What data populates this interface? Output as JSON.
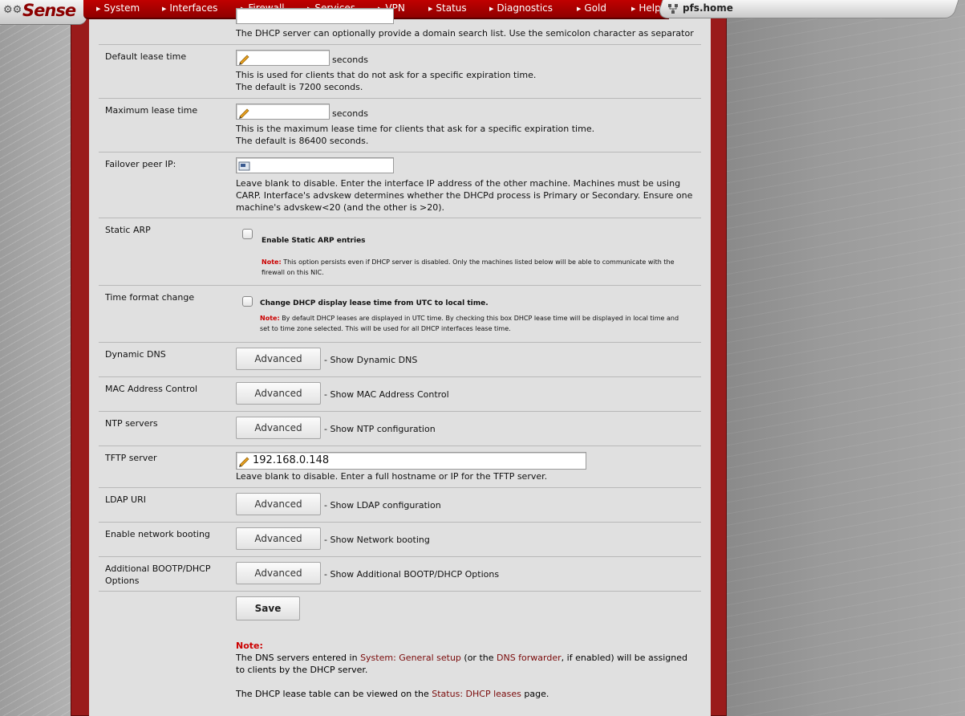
{
  "nav": {
    "logo": "Sense",
    "menu": [
      "System",
      "Interfaces",
      "Firewall",
      "Services",
      "VPN",
      "Status",
      "Diagnostics",
      "Gold",
      "Help"
    ],
    "hostname": "pfs.home"
  },
  "domain_search": {
    "help": "The DHCP server can optionally provide a domain search list. Use the semicolon character as separator"
  },
  "default_lease": {
    "label": "Default lease time",
    "value": "",
    "unit": "seconds",
    "help1": "This is used for clients that do not ask for a specific expiration time.",
    "help2": "The default is 7200 seconds."
  },
  "max_lease": {
    "label": "Maximum lease time",
    "value": "",
    "unit": "seconds",
    "help1": "This is the maximum lease time for clients that ask for a specific expiration time.",
    "help2": "The default is 86400 seconds."
  },
  "failover": {
    "label": "Failover peer IP:",
    "value": "",
    "help1": "Leave blank to disable. Enter the interface IP address of the other machine. Machines must be using",
    "help2": "CARP. Interface's advskew determines whether the DHCPd process is Primary or Secondary. Ensure one",
    "help3": "machine's advskew<20 (and the other is >20)."
  },
  "static_arp": {
    "label": "Static ARP",
    "checkbox_label": "Enable Static ARP entries",
    "checked": false,
    "note_prefix": "Note:",
    "note1": "This option persists even if DHCP server is disabled. Only the machines listed below will be able to communicate with the",
    "note2": "firewall on this NIC."
  },
  "time_format": {
    "label": "Time format change",
    "checkbox_label": "Change DHCP display lease time from UTC to local time.",
    "checked": false,
    "note_prefix": "Note:",
    "note1": "By default DHCP leases are displayed in UTC time. By checking this box DHCP lease time will be displayed in local time and",
    "note2": "set to time zone selected. This will be used for all DHCP interfaces lease time."
  },
  "dynamic_dns": {
    "label": "Dynamic DNS",
    "button": "Advanced",
    "desc": "- Show Dynamic DNS"
  },
  "mac_control": {
    "label": "MAC Address Control",
    "button": "Advanced",
    "desc": "- Show MAC Address Control"
  },
  "ntp": {
    "label": "NTP servers",
    "button": "Advanced",
    "desc": "- Show NTP configuration"
  },
  "tftp": {
    "label": "TFTP server",
    "value": "192.168.0.148",
    "help": "Leave blank to disable. Enter a full hostname or IP for the TFTP server."
  },
  "ldap": {
    "label": "LDAP URI",
    "button": "Advanced",
    "desc": "- Show LDAP configuration"
  },
  "netboot": {
    "label": "Enable network booting",
    "button": "Advanced",
    "desc": "- Show Network booting"
  },
  "bootp": {
    "label": "Additional BOOTP/DHCP Options",
    "button": "Advanced",
    "desc": "- Show Additional BOOTP/DHCP Options"
  },
  "save": "Save",
  "footer": {
    "note_label": "Note:",
    "line1_a": "The DNS servers entered in ",
    "link_general": "System: General setup",
    "line1_b": " (or the ",
    "link_forwarder": "DNS forwarder",
    "line1_c": ", if enabled) will be assigned",
    "line2": "to clients by the DHCP server.",
    "line3_a": "The DHCP lease table can be viewed on the ",
    "link_leases": "Status: DHCP leases",
    "line3_b": " page."
  },
  "colors": {
    "brand": "#9a1b1b",
    "note": "#cc0000",
    "link": "#7a0a0a"
  }
}
